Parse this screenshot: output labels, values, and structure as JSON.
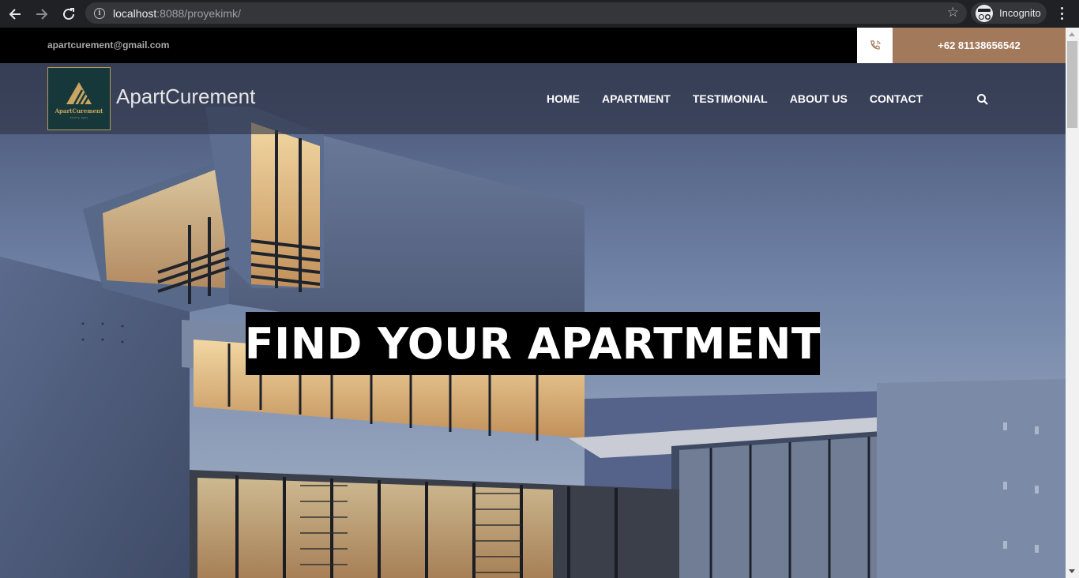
{
  "browser": {
    "url_host": "localhost",
    "url_rest": ":8088/proyekimk/",
    "profile_label": "Incognito"
  },
  "topbar": {
    "email": "apartcurement@gmail.com",
    "phone": "+62 81138656542"
  },
  "header": {
    "logo_text": "ApartCurement",
    "logo_tagline": "Family Apts",
    "brand": "ApartCurement",
    "nav": [
      "HOME",
      "APARTMENT",
      "TESTIMONIAL",
      "ABOUT US",
      "CONTACT"
    ]
  },
  "hero": {
    "headline": "FIND YOUR APARTMENT"
  },
  "colors": {
    "accent": "#a27a5b",
    "logo_bg": "#17383a",
    "logo_gold": "#c8a560",
    "topbar_bg": "#000000"
  }
}
